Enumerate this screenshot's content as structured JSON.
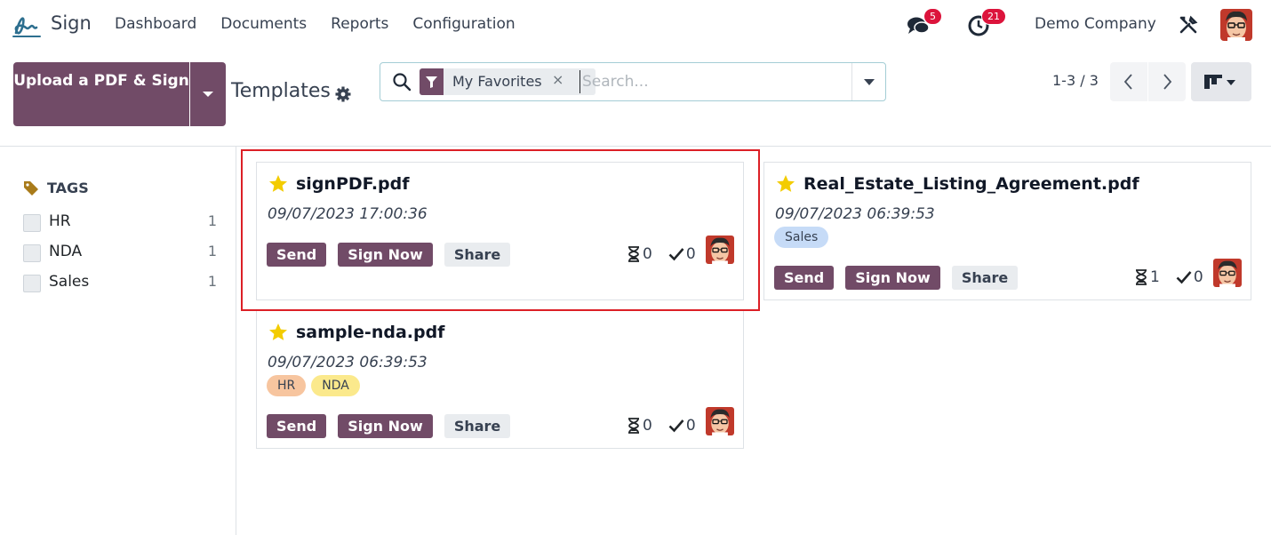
{
  "navbar": {
    "app_name": "Sign",
    "menu": [
      "Dashboard",
      "Documents",
      "Reports",
      "Configuration"
    ],
    "messages_badge": "5",
    "activities_badge": "21",
    "company": "Demo Company"
  },
  "control_panel": {
    "upload_button": "Upload a PDF & Sign",
    "breadcrumb": "Templates",
    "search": {
      "facet_label": "My Favorites",
      "facet_remove": "×",
      "placeholder": "Search..."
    },
    "pager": "1-3 / 3"
  },
  "side_panel": {
    "title": "TAGS",
    "tags": [
      {
        "label": "HR",
        "count": "1"
      },
      {
        "label": "NDA",
        "count": "1"
      },
      {
        "label": "Sales",
        "count": "1"
      }
    ]
  },
  "cards": [
    {
      "title": "signPDF.pdf",
      "date": "09/07/2023 17:00:36",
      "tags": [],
      "send": "Send",
      "sign_now": "Sign Now",
      "share": "Share",
      "pending": "0",
      "signed": "0"
    },
    {
      "title": "Real_Estate_Listing_Agreement.pdf",
      "date": "09/07/2023 06:39:53",
      "tags": [
        "Sales"
      ],
      "send": "Send",
      "sign_now": "Sign Now",
      "share": "Share",
      "pending": "1",
      "signed": "0"
    },
    {
      "title": "sample-nda.pdf",
      "date": "09/07/2023 06:39:53",
      "tags": [
        "HR",
        "NDA"
      ],
      "send": "Send",
      "sign_now": "Sign Now",
      "share": "Share",
      "pending": "0",
      "signed": "0"
    }
  ],
  "colors": {
    "primary": "#714b67",
    "star": "#f3cc00",
    "tag_hr": "#f7c59f",
    "tag_nda": "#fbe98c",
    "tag_sales": "#c6dbf7",
    "highlight": "#dc1f26"
  }
}
